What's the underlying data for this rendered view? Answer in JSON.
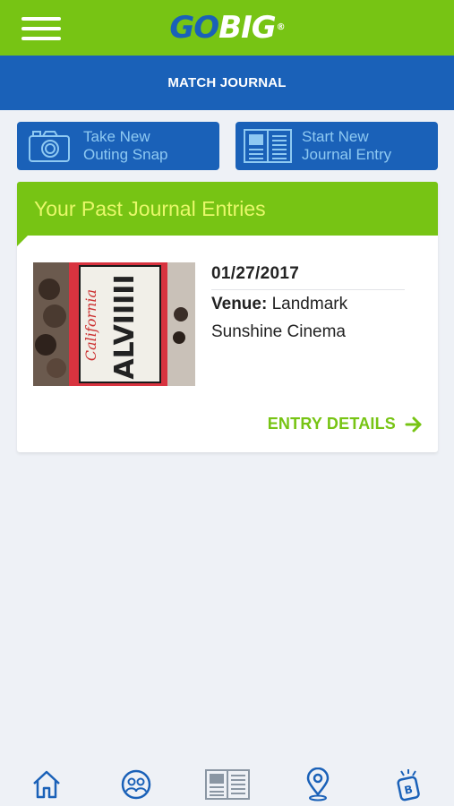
{
  "app": {
    "logo_go": "GO",
    "logo_big": "BIG",
    "logo_mark": "®"
  },
  "header": {
    "title": "MATCH JOURNAL"
  },
  "actions": {
    "snap": {
      "line1": "Take New",
      "line2": "Outing Snap",
      "icon": "camera-icon"
    },
    "journal": {
      "line1": "Start New",
      "line2": "Journal Entry",
      "icon": "journal-icon"
    }
  },
  "past_entries": {
    "heading": "Your Past Journal Entries",
    "entries": [
      {
        "date": "01/27/2017",
        "venue_label": "Venue:",
        "venue": "Landmark Sunshine Cinema",
        "photo_plate_text": "ALVIIIII",
        "photo_plate_state": "California",
        "details_label": "ENTRY DETAILS"
      }
    ]
  },
  "bottom_nav": [
    "home-icon",
    "community-icon",
    "journal-icon",
    "location-pin-icon",
    "badge-icon"
  ],
  "colors": {
    "green": "#77c414",
    "blue": "#1a61b8",
    "light_blue_text": "#8ec9f2",
    "heading_yellow": "#e8f86a"
  }
}
